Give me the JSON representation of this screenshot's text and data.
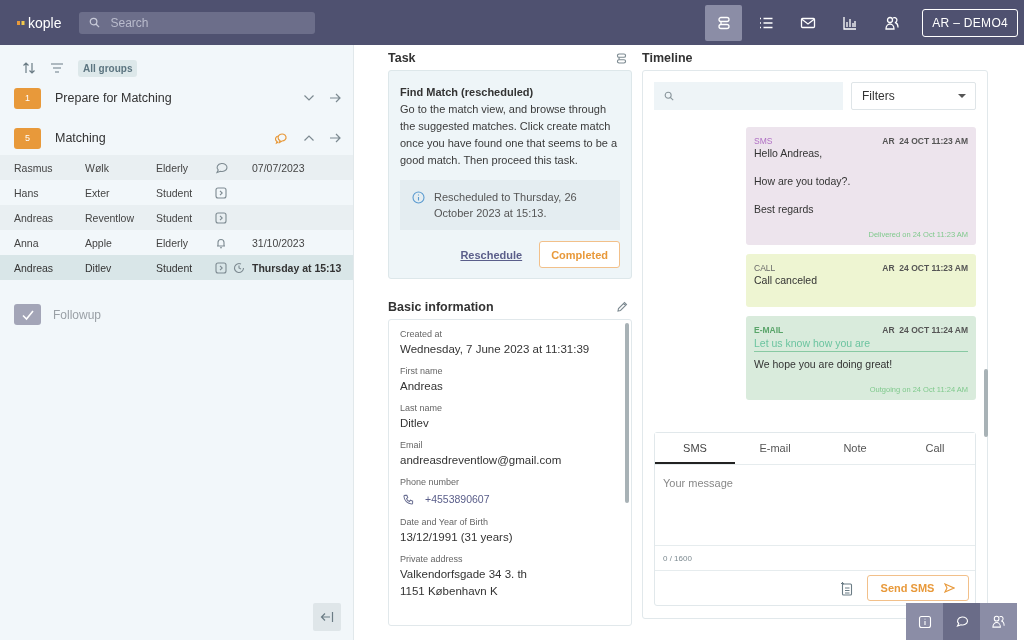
{
  "header": {
    "logo": "kople",
    "search": {
      "placeholder": "Search"
    },
    "nav": [
      {
        "kind": "tasks",
        "selected": true
      },
      {
        "kind": "list",
        "selected": false
      },
      {
        "kind": "mail",
        "selected": false
      },
      {
        "kind": "chart",
        "selected": false
      },
      {
        "kind": "people",
        "selected": false
      }
    ],
    "account": "AR – DEMO4"
  },
  "sidebar": {
    "filter_chip": "All groups",
    "groups": [
      {
        "count": "1",
        "title": "Prepare for Matching",
        "expanded": false,
        "has_comments": false
      },
      {
        "count": "5",
        "title": "Matching",
        "expanded": true,
        "has_comments": true,
        "rows": [
          {
            "first": "Rasmus",
            "last": "Wølk",
            "role": "Elderly",
            "icons": [
              {
                "kind": "chat"
              }
            ],
            "date": "07/07/2023",
            "selected": false
          },
          {
            "first": "Hans",
            "last": "Exter",
            "role": "Student",
            "icons": [
              {
                "kind": "forward"
              }
            ],
            "selected": false
          },
          {
            "first": "Andreas",
            "last": "Reventlow",
            "role": "Student",
            "icons": [
              {
                "kind": "forward"
              }
            ],
            "selected": false
          },
          {
            "first": "Anna",
            "last": "Apple",
            "role": "Elderly",
            "icons": [
              {
                "kind": "bell"
              }
            ],
            "date": "31/10/2023",
            "selected": false
          },
          {
            "first": "Andreas",
            "last": "Ditlev",
            "role": "Student",
            "icons": [
              {
                "kind": "forward"
              },
              {
                "kind": "clock"
              }
            ],
            "date": "Thursday at 15:13",
            "selected": true
          }
        ]
      }
    ],
    "followup": {
      "label": "Followup",
      "checked": true
    }
  },
  "task": {
    "title": "Task",
    "heading": "Find Match (rescheduled)",
    "body": "Go to the match view, and browse through the suggested matches. Click create match once you have found one that seems to be a good match. Then proceed this task.",
    "notice": "Rescheduled to Thursday, 26 October 2023 at 15:13.",
    "link": "Reschedule",
    "button": "Completed"
  },
  "basic_info": {
    "title": "Basic information",
    "fields": [
      {
        "label": "Created at",
        "value": "Wednesday, 7 June 2023 at 11:31:39",
        "kind": "text"
      },
      {
        "label": "First name",
        "value": "Andreas",
        "kind": "text"
      },
      {
        "label": "Last name",
        "value": "Ditlev",
        "kind": "text"
      },
      {
        "label": "Email",
        "value": "andreasdreventlow@gmail.com",
        "kind": "text"
      },
      {
        "label": "Phone number",
        "value": "+4553890607",
        "kind": "phone"
      },
      {
        "label": "Date and Year of Birth",
        "value": "13/12/1991 (31 years)",
        "kind": "text"
      },
      {
        "label": "Private address",
        "value": "Valkendorfsgade 34 3. th",
        "value2": "1151 København K",
        "kind": "text"
      }
    ]
  },
  "timeline": {
    "title": "Timeline",
    "filters": "Filters",
    "entries": [
      {
        "kind": "sms",
        "type": "SMS",
        "author": "AR",
        "time": "24 OCT 11:23 AM",
        "lines": [
          "Hello Andreas,",
          "How are you today?.",
          "Best regards"
        ],
        "footer": "Delivered on 24 Oct 11:23 AM"
      },
      {
        "kind": "call",
        "type": "CALL",
        "author": "AR",
        "time": "24 OCT 11:23 AM",
        "lines": [
          "Call canceled"
        ]
      },
      {
        "kind": "email",
        "type": "E-MAIL",
        "author": "AR",
        "time": "24 OCT 11:24 AM",
        "subject": "Let us know how you are",
        "lines": [
          "We hope you are doing great!"
        ],
        "footer": "Outgoing on 24 Oct 11:24 AM"
      }
    ],
    "composer": {
      "tabs": [
        {
          "label": "SMS",
          "selected": true
        },
        {
          "label": "E-mail",
          "selected": false
        },
        {
          "label": "Note",
          "selected": false
        },
        {
          "label": "Call",
          "selected": false
        }
      ],
      "placeholder": "Your message",
      "counter": "0 / 1600",
      "send": "Send SMS"
    }
  },
  "dock": [
    {
      "kind": "info",
      "selected": false
    },
    {
      "kind": "chat",
      "selected": true
    },
    {
      "kind": "people",
      "selected": false
    }
  ]
}
